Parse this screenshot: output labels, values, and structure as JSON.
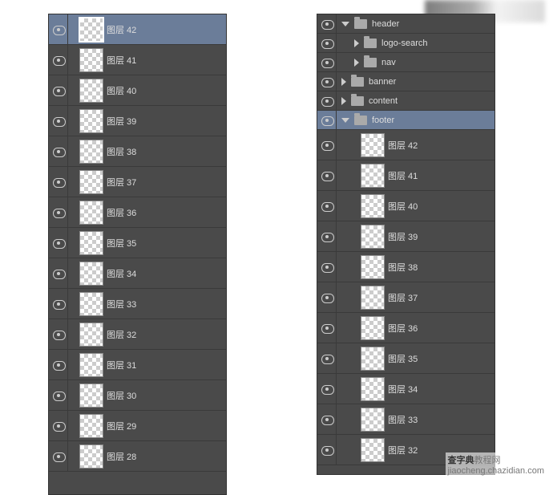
{
  "leftPanel": {
    "layers": [
      {
        "name": "图层 42",
        "selected": true
      },
      {
        "name": "图层 41",
        "selected": false
      },
      {
        "name": "图层 40",
        "selected": false
      },
      {
        "name": "图层 39",
        "selected": false
      },
      {
        "name": "图层 38",
        "selected": false
      },
      {
        "name": "图层 37",
        "selected": false
      },
      {
        "name": "图层 36",
        "selected": false
      },
      {
        "name": "图层 35",
        "selected": false
      },
      {
        "name": "图层 34",
        "selected": false
      },
      {
        "name": "图层 33",
        "selected": false
      },
      {
        "name": "图层 32",
        "selected": false
      },
      {
        "name": "图层 31",
        "selected": false
      },
      {
        "name": "图层 30",
        "selected": false
      },
      {
        "name": "图层 29",
        "selected": false
      },
      {
        "name": "图层 28",
        "selected": false
      }
    ]
  },
  "rightPanel": {
    "groups": [
      {
        "name": "header",
        "indent": 0,
        "open": true,
        "selected": false
      },
      {
        "name": "logo-search",
        "indent": 1,
        "open": false,
        "selected": false
      },
      {
        "name": "nav",
        "indent": 1,
        "open": false,
        "selected": false
      },
      {
        "name": "banner",
        "indent": 0,
        "open": false,
        "selected": false
      },
      {
        "name": "content",
        "indent": 0,
        "open": false,
        "selected": false
      },
      {
        "name": "footer",
        "indent": 0,
        "open": true,
        "selected": true
      }
    ],
    "layers": [
      {
        "name": "图层 42"
      },
      {
        "name": "图层 41"
      },
      {
        "name": "图层 40"
      },
      {
        "name": "图层 39"
      },
      {
        "name": "图层 38"
      },
      {
        "name": "图层 37"
      },
      {
        "name": "图层 36"
      },
      {
        "name": "图层 35"
      },
      {
        "name": "图层 34"
      },
      {
        "name": "图层 33"
      },
      {
        "name": "图层 32"
      }
    ]
  },
  "watermark": {
    "brand": "查字典",
    "suffix": "教程网",
    "url": "jiaocheng.chazidian.com"
  }
}
